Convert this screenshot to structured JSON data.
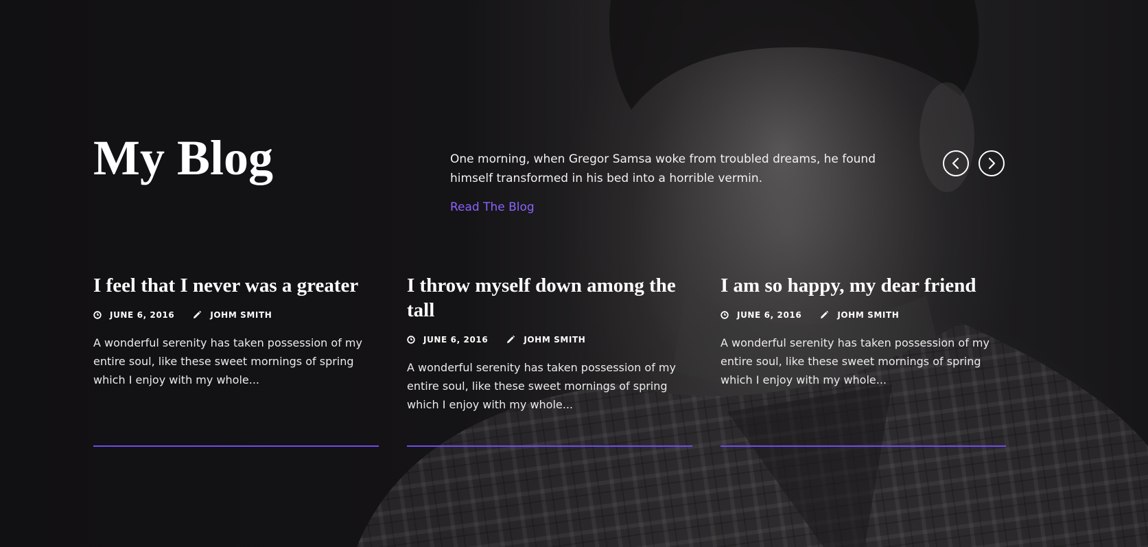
{
  "header": {
    "title": "My Blog",
    "intro": "One morning, when Gregor Samsa woke from troubled dreams, he found himself transformed in his bed into a horrible vermin.",
    "read_link": "Read The Blog"
  },
  "carousel": {
    "prev_icon": "chevron-left-circle-icon",
    "next_icon": "chevron-right-circle-icon"
  },
  "posts": [
    {
      "title": "I feel that I never was a greater",
      "date": "JUNE 6, 2016",
      "author": "JOHM SMITH",
      "excerpt": "A wonderful serenity has taken possession of my entire soul, like these sweet mornings of spring which I enjoy with my whole..."
    },
    {
      "title": "I throw myself down among the tall",
      "date": "JUNE 6, 2016",
      "author": "JOHM SMITH",
      "excerpt": "A wonderful serenity has taken possession of my entire soul, like these sweet mornings of spring which I enjoy with my whole..."
    },
    {
      "title": "I am so happy, my dear friend",
      "date": "JUNE 6, 2016",
      "author": "JOHM SMITH",
      "excerpt": "A wonderful serenity has taken possession of my entire soul, like these sweet mornings of spring which I enjoy with my whole..."
    }
  ],
  "colors": {
    "accent": "#6f4cf0",
    "link": "#8a64ff",
    "background": "#131214"
  },
  "icons": {
    "date": "clock-icon",
    "author": "pencil-icon"
  }
}
